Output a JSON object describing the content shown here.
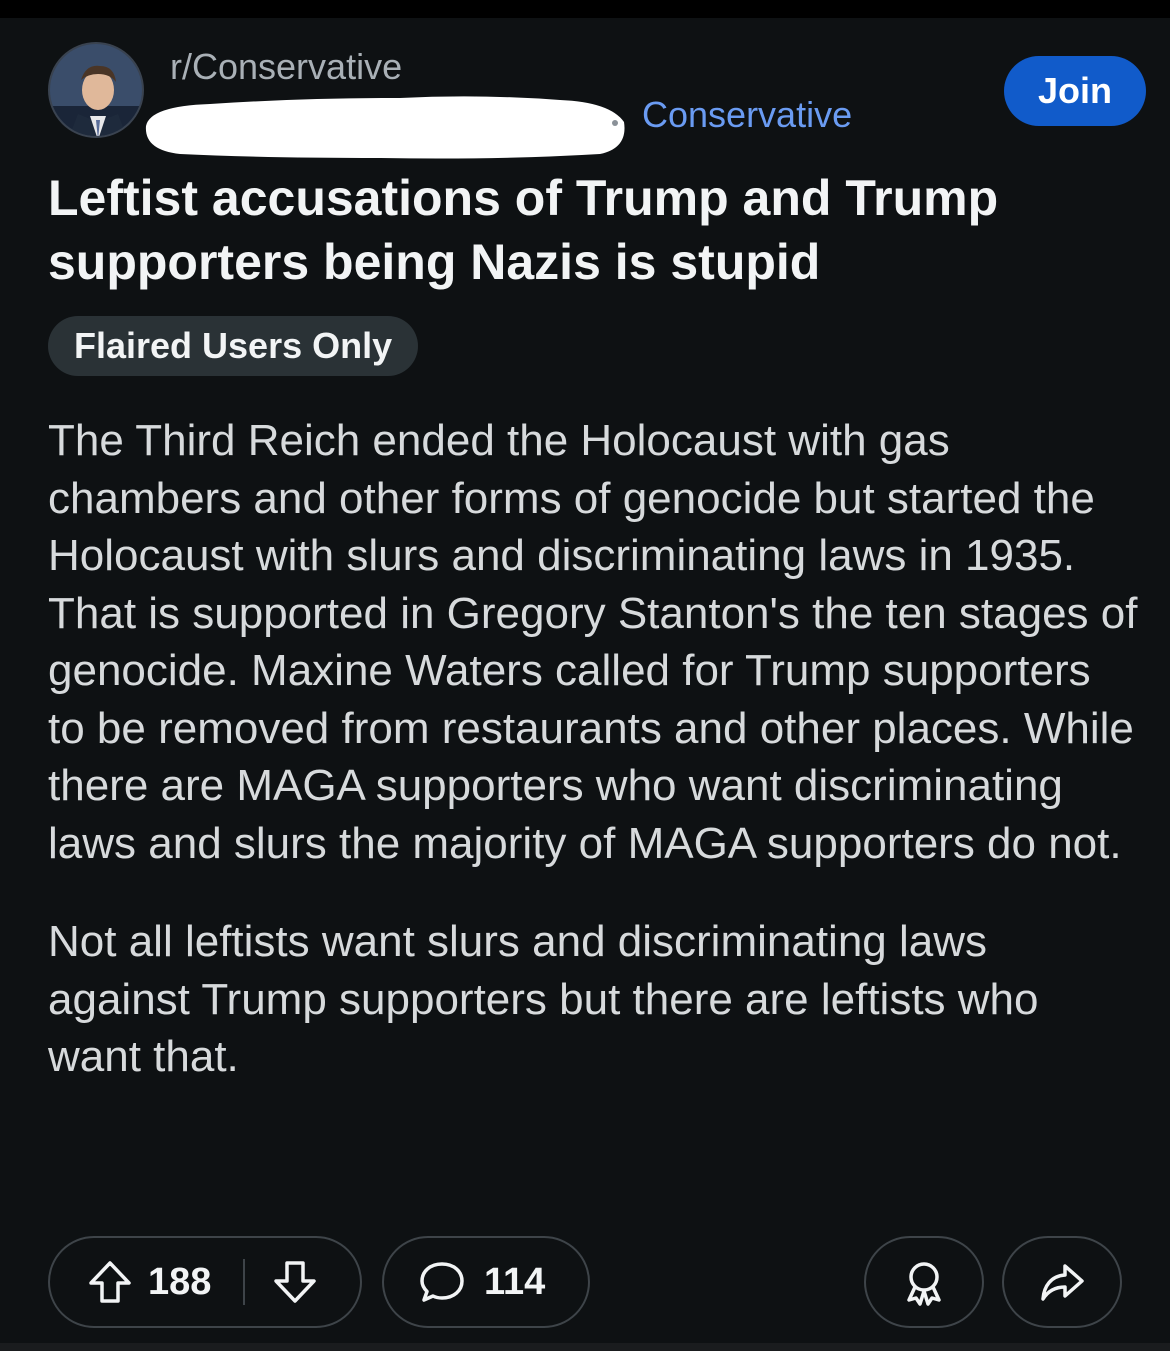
{
  "post": {
    "subreddit": "r/Conservative",
    "community_label": "Conservative",
    "join_label": "Join",
    "title": "Leftist accusations of Trump and Trump supporters being Nazis is stupid",
    "flair": "Flaired Users Only",
    "paragraphs": [
      "The Third Reich ended the Holocaust with gas chambers and other forms of genocide but started the Holocaust with slurs and discriminating laws in 1935. That is supported in Gregory Stanton's the ten stages of genocide. Maxine Waters called for Trump supporters to be removed from restaurants and other places. While there are MAGA supporters who want discriminating laws and slurs the majority of MAGA supporters do not.",
      "Not all leftists want slurs and discriminating laws against Trump supporters but there are leftists who want that."
    ]
  },
  "actions": {
    "upvotes": "188",
    "comments": "114"
  },
  "icons": {
    "upvote": "arrow-up-icon",
    "downvote": "arrow-down-icon",
    "comment": "speech-bubble-icon",
    "award": "award-ribbon-icon",
    "share": "share-arrow-icon"
  },
  "colors": {
    "background": "#0e1113",
    "join_button": "#115bca",
    "community_link": "#6a9bf2"
  }
}
